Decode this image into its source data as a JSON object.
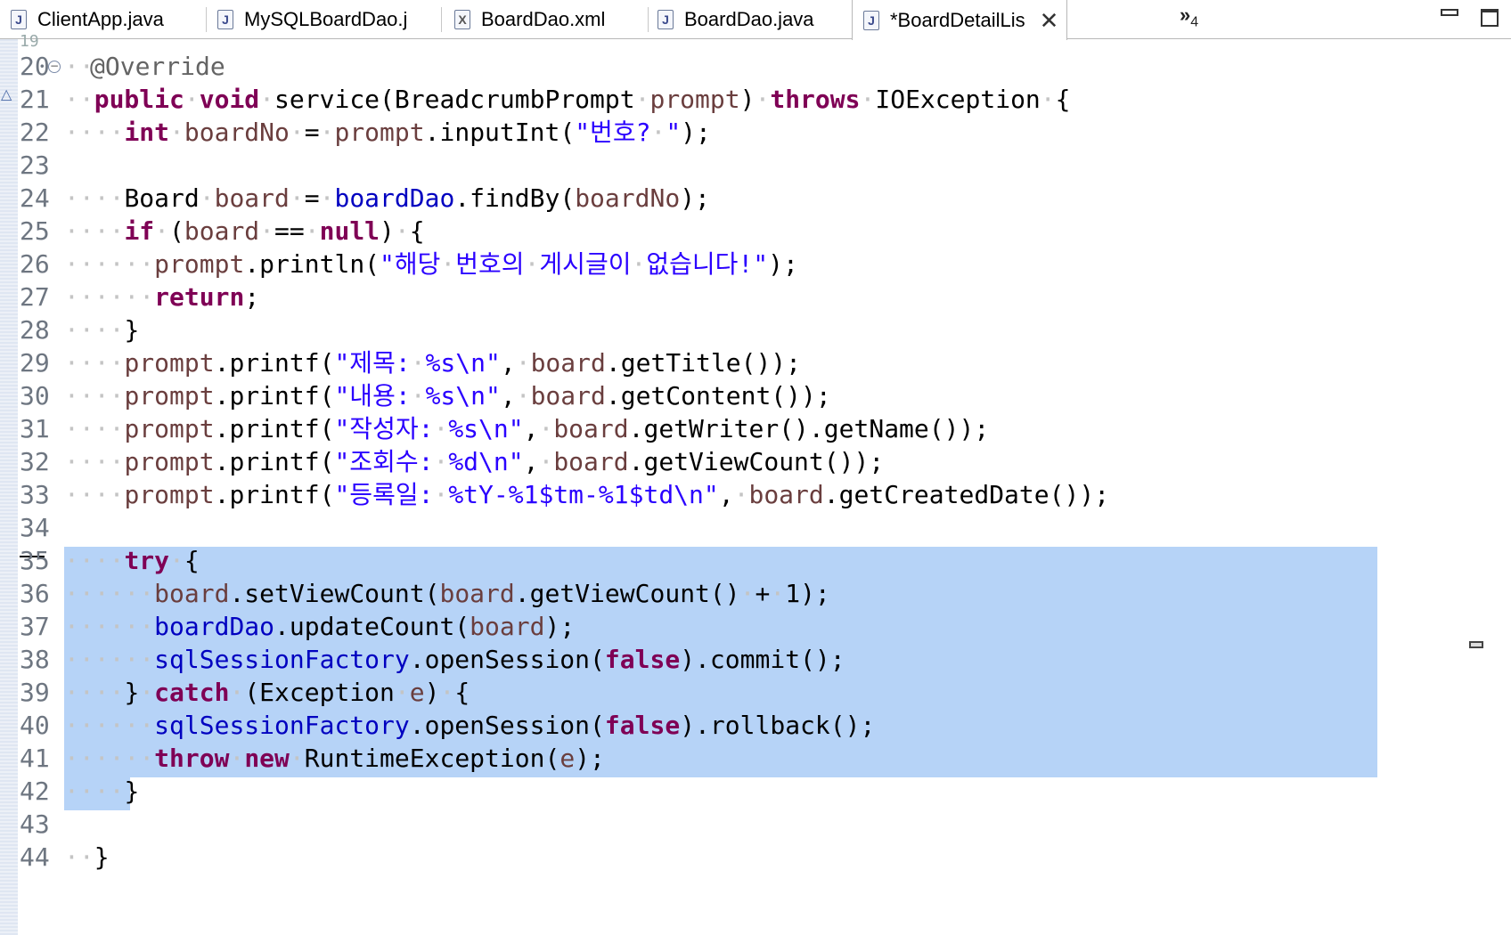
{
  "tabs": [
    {
      "label": "ClientApp.java",
      "icon": "java-file-icon",
      "active": false
    },
    {
      "label": "MySQLBoardDao.j",
      "icon": "java-file-icon",
      "active": false
    },
    {
      "label": "BoardDao.xml",
      "icon": "xml-file-icon",
      "active": false
    },
    {
      "label": "BoardDao.java",
      "icon": "java-file-icon",
      "active": false
    },
    {
      "label": "*BoardDetailLis",
      "icon": "java-file-icon",
      "active": true
    }
  ],
  "overflow": {
    "label": "»",
    "count": "4"
  },
  "editor": {
    "top_partial_line_number": "19",
    "lines": [
      {
        "n": "20"
      },
      {
        "n": "21"
      },
      {
        "n": "22"
      },
      {
        "n": "23"
      },
      {
        "n": "24"
      },
      {
        "n": "25"
      },
      {
        "n": "26"
      },
      {
        "n": "27"
      },
      {
        "n": "28"
      },
      {
        "n": "29"
      },
      {
        "n": "30"
      },
      {
        "n": "31"
      },
      {
        "n": "32"
      },
      {
        "n": "33"
      },
      {
        "n": "34"
      },
      {
        "n": "35"
      },
      {
        "n": "36"
      },
      {
        "n": "37"
      },
      {
        "n": "38"
      },
      {
        "n": "39"
      },
      {
        "n": "40"
      },
      {
        "n": "41"
      },
      {
        "n": "42"
      },
      {
        "n": "43"
      },
      {
        "n": "44"
      }
    ],
    "tokens": {
      "l20": {
        "ann": "@Override"
      },
      "l21": {
        "k1": "public",
        "k2": "void",
        "t1": "service(BreadcrumbPrompt",
        "v1": "prompt",
        "t2": ")",
        "k3": "throws",
        "t3": "IOException",
        "t4": "{"
      },
      "l22": {
        "k1": "int",
        "v1": "boardNo",
        "t1": "=",
        "v2": "prompt",
        "t2": ".inputInt(",
        "s1": "\"번호?",
        "s2": "\"",
        "t3": ");"
      },
      "l24": {
        "t1": "Board",
        "v1": "board",
        "t2": "=",
        "f1": "boardDao",
        "t3": ".findBy(",
        "v2": "boardNo",
        "t4": ");"
      },
      "l25": {
        "k1": "if",
        "t1": "(",
        "v1": "board",
        "t2": "==",
        "k2": "null",
        "t3": ")",
        "t4": "{"
      },
      "l26": {
        "v1": "prompt",
        "t1": ".println(",
        "s1": "\"해당",
        "s2": "번호의",
        "s3": "게시글이",
        "s4": "없습니다!\"",
        "t2": ");"
      },
      "l27": {
        "k1": "return",
        "t1": ";"
      },
      "l28": {
        "t1": "}"
      },
      "l29": {
        "v1": "prompt",
        "t1": ".printf(",
        "s1": "\"제목:",
        "s2": "%s\\n\"",
        "t2": ",",
        "v2": "board",
        "t3": ".getTitle());"
      },
      "l30": {
        "v1": "prompt",
        "t1": ".printf(",
        "s1": "\"내용:",
        "s2": "%s\\n\"",
        "t2": ",",
        "v2": "board",
        "t3": ".getContent());"
      },
      "l31": {
        "v1": "prompt",
        "t1": ".printf(",
        "s1": "\"작성자:",
        "s2": "%s\\n\"",
        "t2": ",",
        "v2": "board",
        "t3": ".getWriter().getName());"
      },
      "l32": {
        "v1": "prompt",
        "t1": ".printf(",
        "s1": "\"조회수:",
        "s2": "%d\\n\"",
        "t2": ",",
        "v2": "board",
        "t3": ".getViewCount());"
      },
      "l33": {
        "v1": "prompt",
        "t1": ".printf(",
        "s1": "\"등록일:",
        "s2": "%tY-%1$tm-%1$td\\n\"",
        "t2": ",",
        "v2": "board",
        "t3": ".getCreatedDate());"
      },
      "l35": {
        "k1": "try",
        "t1": "{"
      },
      "l36": {
        "v1": "board",
        "t1": ".setViewCount(",
        "v2": "board",
        "t2": ".getViewCount()",
        "t3": "+",
        "t4": "1);"
      },
      "l37": {
        "f1": "boardDao",
        "t1": ".updateCount(",
        "v1": "board",
        "t2": ");"
      },
      "l38": {
        "f1": "sqlSessionFactory",
        "t1": ".openSession(",
        "k1": "false",
        "t2": ").commit();"
      },
      "l39": {
        "t1": "}",
        "k1": "catch",
        "t2": "(Exception",
        "v1": "e",
        "t3": ")",
        "t4": "{"
      },
      "l40": {
        "f1": "sqlSessionFactory",
        "t1": ".openSession(",
        "k1": "false",
        "t2": ").rollback();"
      },
      "l41": {
        "k1": "throw",
        "k2": "new",
        "t1": "RuntimeException(",
        "v1": "e",
        "t2": ");"
      },
      "l42": {
        "t1": "}"
      },
      "l44": {
        "t1": "}"
      }
    }
  },
  "colors": {
    "keyword": "#7f0055",
    "string": "#2a00ff",
    "field": "#0000c0",
    "local_variable": "#6a3e3e",
    "selection": "#b6d3f7"
  }
}
